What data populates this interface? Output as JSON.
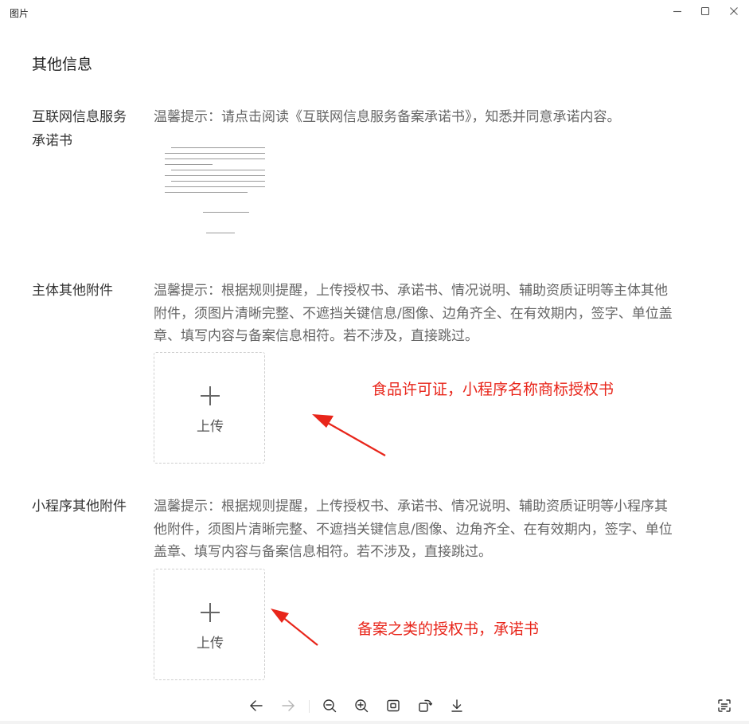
{
  "window": {
    "title": "图片"
  },
  "section": {
    "title": "其他信息"
  },
  "icp_commitment": {
    "label": "互联网信息服务承诺书",
    "hint": "温馨提示：请点击阅读《互联网信息服务备案承诺书》，知悉并同意承诺内容。"
  },
  "entity_attachments": {
    "label": "主体其他附件",
    "hint": "温馨提示：根据规则提醒，上传授权书、承诺书、情况说明、辅助资质证明等主体其他附件，须图片清晰完整、不遮挡关键信息/图像、边角齐全、在有效期内，签字、单位盖章、填写内容与备案信息相符。若不涉及，直接跳过。",
    "upload_label": "上传",
    "annotation": "食品许可证，小程序名称商标授权书"
  },
  "miniprogram_attachments": {
    "label": "小程序其他附件",
    "hint": "温馨提示：根据规则提醒，上传授权书、承诺书、情况说明、辅助资质证明等小程序其他附件，须图片清晰完整、不遮挡关键信息/图像、边角齐全、在有效期内，签字、单位盖章、填写内容与备案信息相符。若不涉及，直接跳过。",
    "upload_label": "上传",
    "annotation": "备案之类的授权书，承诺书"
  },
  "colors": {
    "annotation": "#e8251a",
    "hint_text": "#666666",
    "upload_border": "#cfcfcf"
  },
  "toolbar": {
    "icons": [
      "arrow-left-icon",
      "arrow-right-icon",
      "zoom-out-icon",
      "zoom-in-icon",
      "fit-screen-icon",
      "rotate-icon",
      "download-icon",
      "ocr-scan-icon"
    ]
  }
}
